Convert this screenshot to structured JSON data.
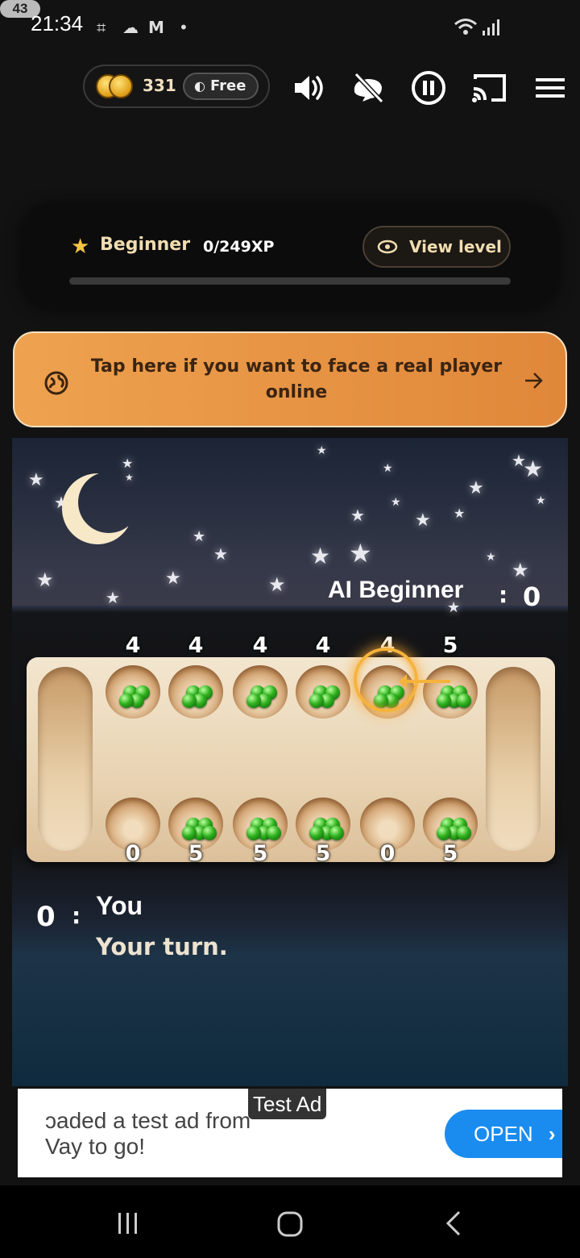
{
  "status_bar": {
    "time": "21:34",
    "battery": "43"
  },
  "toolbar": {
    "coins": "331",
    "free_label": "Free"
  },
  "level": {
    "name": "Beginner",
    "xp": "0/249XP",
    "view_level_label": "View level",
    "xp_progress": 0
  },
  "banner": {
    "text": "Tap here if you want to face a real player online"
  },
  "game": {
    "opponent_label": "AI Beginner",
    "opponent_score": "0",
    "colon": ":",
    "player_label": "You",
    "player_score": "0",
    "turn_text": "Your turn.",
    "top_pits": [
      "4",
      "4",
      "4",
      "4",
      "4",
      "5"
    ],
    "bottom_pits": [
      "0",
      "5",
      "5",
      "5",
      "0",
      "5"
    ]
  },
  "ad": {
    "badge": "Test Ad",
    "line1": "ɔaded a test ad from",
    "line2": "Vay to go!",
    "open_label": "OPEN"
  },
  "colors": {
    "accent_orange": "#e8913f",
    "gold": "#f4c443",
    "marble_green": "#2fb11e",
    "ad_button": "#1a8cf0"
  }
}
